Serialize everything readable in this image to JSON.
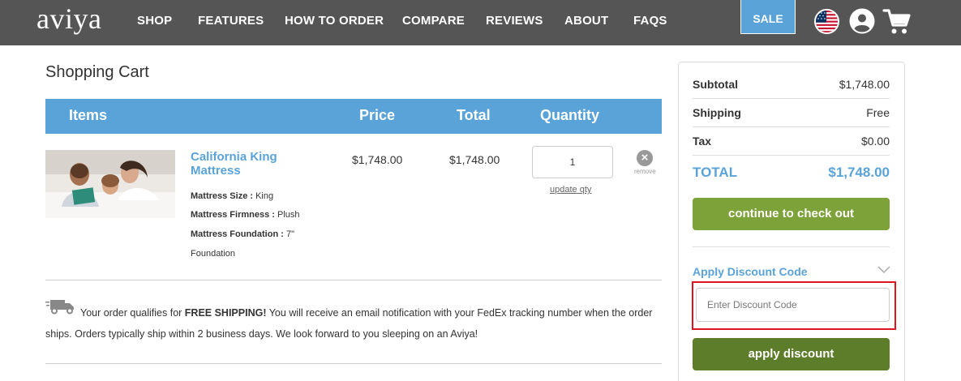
{
  "header": {
    "logo": "aviya",
    "nav": [
      "SHOP",
      "FEATURES",
      "HOW TO ORDER",
      "COMPARE",
      "REVIEWS",
      "ABOUT",
      "FAQS"
    ],
    "sale_label": "SALE",
    "icons": [
      "us-flag-icon",
      "account-icon",
      "shopping-cart-icon"
    ],
    "colors": {
      "bar": "#555555",
      "accent": "#5aa3d8"
    }
  },
  "page": {
    "title": "Shopping Cart"
  },
  "cart_table": {
    "headers": {
      "items": "Items",
      "price": "Price",
      "total": "Total",
      "quantity": "Quantity"
    },
    "rows": [
      {
        "name": "California King Mattress",
        "attributes": [
          {
            "label": "Mattress Size :",
            "value": "King"
          },
          {
            "label": "Mattress Firmness :",
            "value": "Plush"
          },
          {
            "label": "Mattress Foundation :",
            "value": "7\""
          },
          {
            "label": "",
            "value": "Foundation"
          }
        ],
        "price": "$1,748.00",
        "total": "$1,748.00",
        "quantity": "1",
        "update_label": "update qty",
        "remove_label": "remove"
      }
    ]
  },
  "shipping_notice": {
    "prefix": "Your order qualifies for ",
    "highlight": "FREE SHIPPING!",
    "suffix": " You will receive an email notification with your FedEx tracking number when the order ships.  Orders typically ship within 2 business days. We look forward to you sleeping on an Aviya!"
  },
  "summary": {
    "subtotal_label": "Subtotal",
    "subtotal_value": "$1,748.00",
    "shipping_label": "Shipping",
    "shipping_value": "Free",
    "tax_label": "Tax",
    "tax_value": "$0.00",
    "total_label": "TOTAL",
    "total_value": "$1,748.00",
    "checkout_label": "continue to check out",
    "discount_heading": "Apply Discount Code",
    "discount_placeholder": "Enter Discount Code",
    "apply_label": "apply discount",
    "colors": {
      "checkout": "#7ea23a",
      "apply": "#5e7d2a",
      "highlight_border": "#e0141e"
    }
  }
}
